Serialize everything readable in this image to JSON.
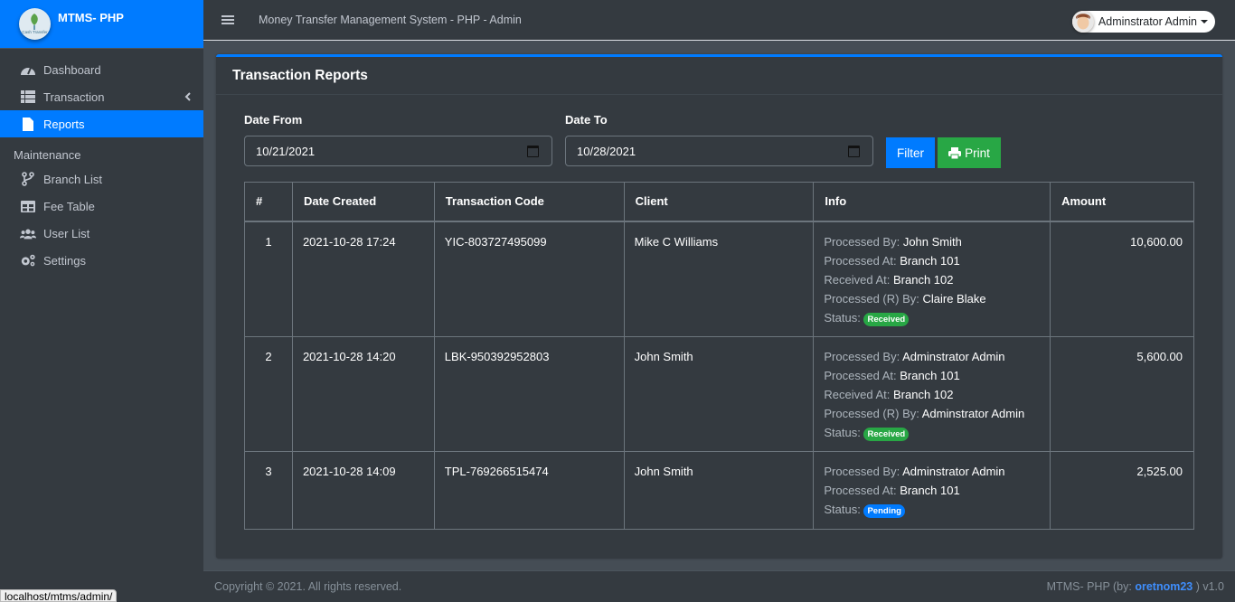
{
  "brand": {
    "name": "MTMS- PHP",
    "logo_text": "Cash Transfer"
  },
  "sidebar": {
    "items": [
      {
        "label": "Dashboard",
        "icon": "tachometer-icon",
        "active": false
      },
      {
        "label": "Transaction",
        "icon": "list-icon",
        "active": false,
        "has_submenu": true
      },
      {
        "label": "Reports",
        "icon": "file-icon",
        "active": true
      }
    ],
    "maintenance_header": "Maintenance",
    "maintenance_items": [
      {
        "label": "Branch List",
        "icon": "code-branch-icon"
      },
      {
        "label": "Fee Table",
        "icon": "table-icon"
      },
      {
        "label": "User List",
        "icon": "users-icon"
      },
      {
        "label": "Settings",
        "icon": "cogs-icon"
      }
    ]
  },
  "topbar": {
    "title": "Money Transfer Management System - PHP - Admin",
    "user_name": "Adminstrator Admin"
  },
  "card": {
    "title": "Transaction Reports",
    "date_from_label": "Date From",
    "date_from_value": "10/21/2021",
    "date_to_label": "Date To",
    "date_to_value": "10/28/2021",
    "filter_label": "Filter",
    "print_label": "Print"
  },
  "table": {
    "headers": [
      "#",
      "Date Created",
      "Transaction Code",
      "Client",
      "Info",
      "Amount"
    ],
    "rows": [
      {
        "num": "1",
        "date": "2021-10-28 17:24",
        "code": "YIC-803727495099",
        "client": "Mike C Williams",
        "info": [
          {
            "k": "Processed By:",
            "v": "John Smith"
          },
          {
            "k": "Processed At:",
            "v": "Branch 101"
          },
          {
            "k": "Received At:",
            "v": "Branch 102"
          },
          {
            "k": "Processed (R) By:",
            "v": "Claire Blake"
          }
        ],
        "status_label": "Status:",
        "status": "Received",
        "status_color": "#28a745",
        "amount": "10,600.00"
      },
      {
        "num": "2",
        "date": "2021-10-28 14:20",
        "code": "LBK-950392952803",
        "client": "John Smith",
        "info": [
          {
            "k": "Processed By:",
            "v": "Adminstrator Admin"
          },
          {
            "k": "Processed At:",
            "v": "Branch 101"
          },
          {
            "k": "Received At:",
            "v": "Branch 102"
          },
          {
            "k": "Processed (R) By:",
            "v": "Adminstrator Admin"
          }
        ],
        "status_label": "Status:",
        "status": "Received",
        "status_color": "#28a745",
        "amount": "5,600.00"
      },
      {
        "num": "3",
        "date": "2021-10-28 14:09",
        "code": "TPL-769266515474",
        "client": "John Smith",
        "info": [
          {
            "k": "Processed By:",
            "v": "Adminstrator Admin"
          },
          {
            "k": "Processed At:",
            "v": "Branch 101"
          }
        ],
        "status_label": "Status:",
        "status": "Pending",
        "status_color": "#007bff",
        "amount": "2,525.00"
      }
    ]
  },
  "footer": {
    "copyright": "Copyright © 2021. All rights reserved.",
    "credit_prefix": "MTMS- PHP (by: ",
    "credit_author": "oretnom23",
    "credit_suffix": " ) v1.0"
  },
  "statusbar": {
    "url": "localhost/mtms/admin/"
  },
  "colors": {
    "primary": "#007bff",
    "success": "#28a745",
    "sidebar_bg": "#343a40",
    "content_bg": "#454d55"
  }
}
